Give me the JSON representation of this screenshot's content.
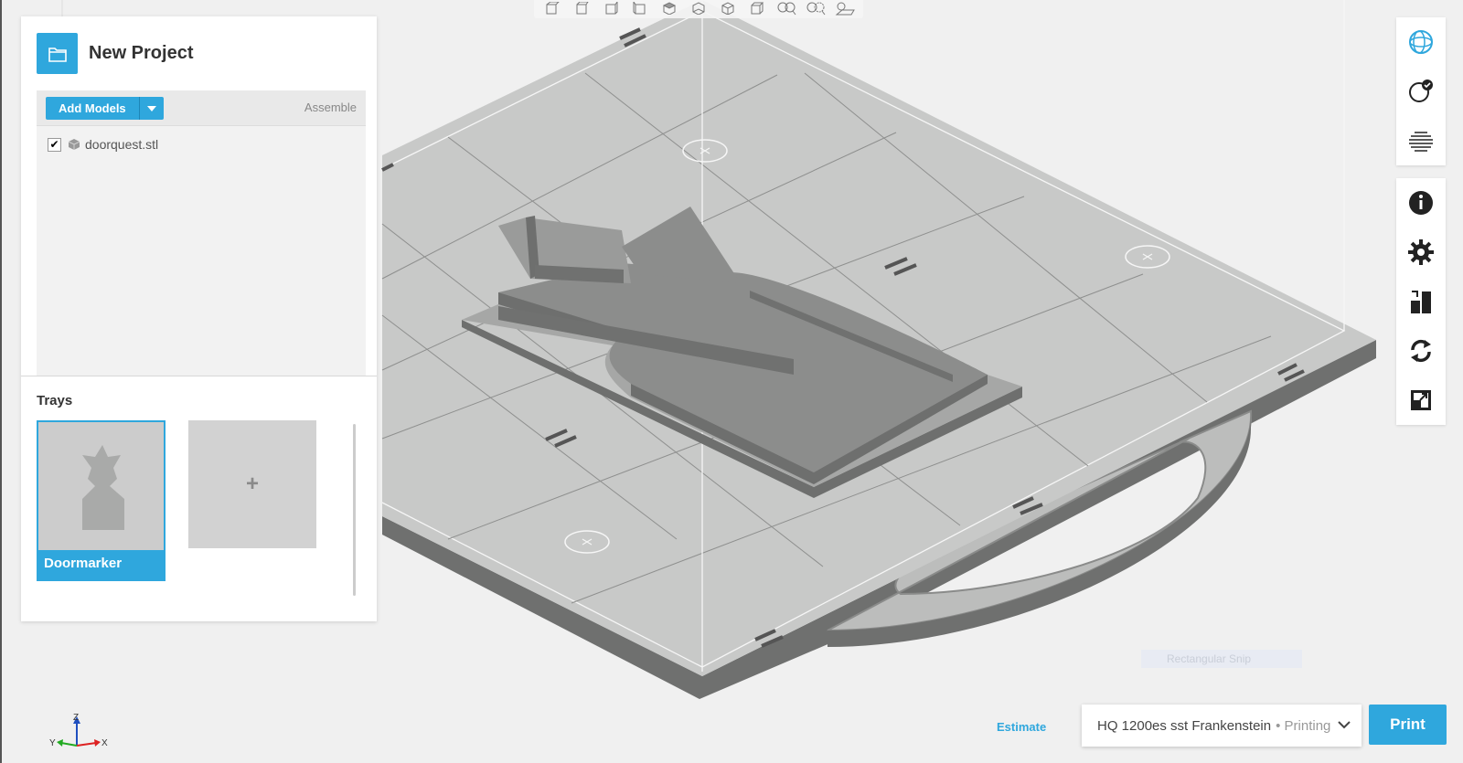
{
  "project": {
    "title": "New Project",
    "add_models_label": "Add Models",
    "assemble_label": "Assemble",
    "models": [
      {
        "name": "doorquest.stl",
        "checked": true
      }
    ]
  },
  "trays": {
    "title": "Trays",
    "items": [
      {
        "label": "Doormarker",
        "selected": true
      }
    ],
    "add_label": "+"
  },
  "bottom_bar": {
    "estimate_label": "Estimate",
    "printer_name": "HQ 1200es sst Frankenstein",
    "printer_status": "• Printing",
    "print_label": "Print"
  },
  "axis": {
    "x": "X",
    "y": "Y",
    "z": "Z"
  },
  "overlay": {
    "snip_label": "Rectangular Snip"
  },
  "colors": {
    "accent": "#2fa7dd",
    "tray_surface": "#c8c9c8",
    "model": "#8c8d8c"
  }
}
